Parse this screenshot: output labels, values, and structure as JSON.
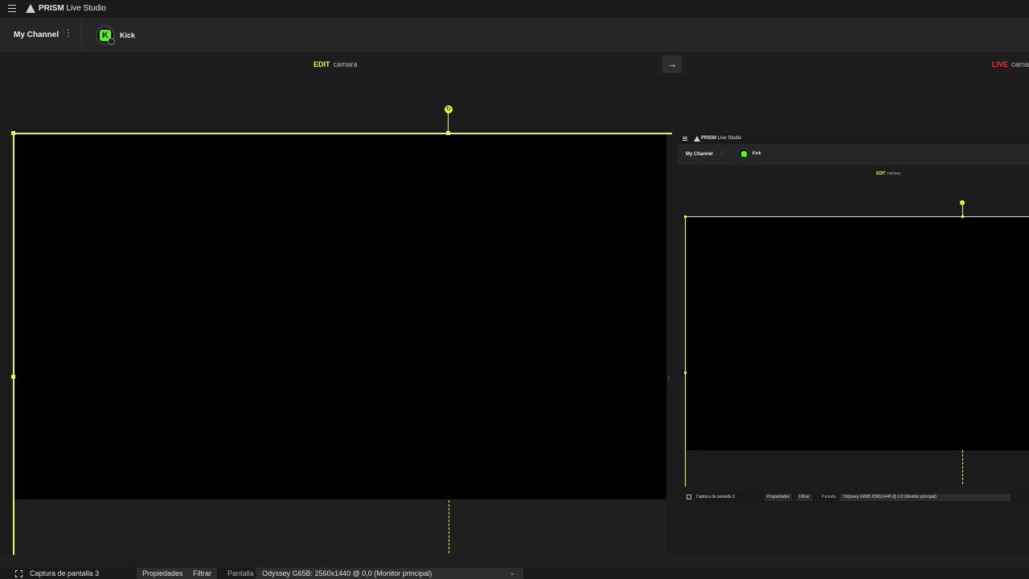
{
  "app": {
    "brand": "PRISM",
    "title_rest": "Live Studio"
  },
  "channel": {
    "name": "My Channel",
    "platform_label": "Kick",
    "platform_glyph": "K"
  },
  "edit_header": {
    "edit_tag": "EDIT",
    "edit_scene": "camara",
    "live_tag": "LIVE",
    "live_scene": "cama",
    "swap_glyph": "→"
  },
  "source_bar": {
    "source_name": "Captura de pantalla 3",
    "properties_label": "Propiedades",
    "filter_label": "Filtrar",
    "display_label": "Pantalla",
    "display_value": "Odyssey G65B: 2560x1440 @ 0,0 (Monitor principal)"
  },
  "mini_preview": {
    "brand": "PRISM",
    "title_rest": "Live Studio",
    "channel_name": "My Channel",
    "platform_label": "Kick",
    "edit_tag": "EDIT",
    "edit_scene": "camara",
    "source_name": "Captura de pantalla 3",
    "properties_label": "Propiedades",
    "filter_label": "Filtrar",
    "display_label": "Pantalla",
    "display_value": "Odyssey G65B 2560x1440 @ 0,0 (Monitor principal)"
  },
  "colors": {
    "accent": "#dfff3a",
    "live": "#ff2b3a",
    "kick_green": "#53fc18"
  }
}
